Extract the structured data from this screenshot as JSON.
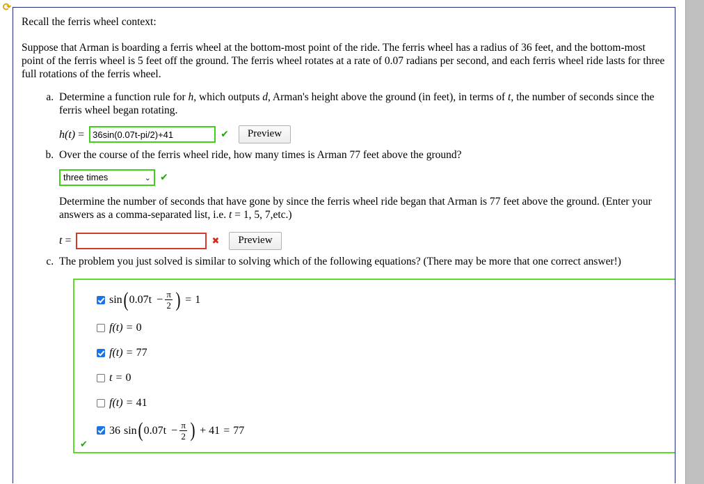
{
  "reload_icon": "⟳",
  "intro": {
    "recall_line": "Recall the ferris wheel context:",
    "setup_text": "Suppose that Arman is boarding a ferris wheel at the bottom-most point of the ride. The ferris wheel has a radius of 36 feet, and the bottom-most point of the ferris wheel is 5 feet off the ground. The ferris wheel rotates at a rate of 0.07 radians per second, and each ferris wheel ride lasts for three full rotations of the ferris wheel."
  },
  "part_a": {
    "prompt": "Determine a function rule for h, which outputs d, Arman's height above the ground (in feet), in terms of t, the number of seconds since the ferris wheel began rotating.",
    "label_fn": "h(t)",
    "label_eq": "=",
    "input_value": "36sin(0.07t-pi/2)+41",
    "status_mark": "✔",
    "status": "correct",
    "preview_label": "Preview"
  },
  "part_b": {
    "prompt": "Over the course of the ferris wheel ride, how many times is Arman 77 feet above the ground?",
    "select_value": "three times",
    "select_chevron": "⌄",
    "select_status_mark": "✔",
    "follow_up": "Determine the number of seconds that have gone by since the ferris wheel ride began that Arman is 77 feet above the ground. (Enter your answers as a comma-separated list, i.e. t = 1, 5, 7,etc.)",
    "label_t": "t",
    "label_eq": "=",
    "input_value": "",
    "status_mark": "✖",
    "status": "incorrect",
    "preview_label": "Preview"
  },
  "part_c": {
    "prompt": "The problem you just solved is similar to solving which of the following equations? (There may be more that one correct answer!)",
    "panel_status_mark": "✔",
    "choices": [
      {
        "checked": true,
        "kind": "sin_fraction",
        "coefficient": "",
        "func": "sin",
        "arg_left": "0.07t",
        "minus": "−",
        "frac_num": "π",
        "frac_den": "2",
        "tail": "",
        "equals": "=",
        "rhs": "1",
        "plain": "sin(0.07t − π/2) = 1"
      },
      {
        "checked": false,
        "kind": "plain",
        "plain": "f(t) = 0",
        "lhs_fn": "f",
        "lhs_arg": "(t)",
        "equals": "=",
        "rhs": "0"
      },
      {
        "checked": true,
        "kind": "plain",
        "plain": "f(t) = 77",
        "lhs_fn": "f",
        "lhs_arg": "(t)",
        "equals": "=",
        "rhs": "77"
      },
      {
        "checked": false,
        "kind": "plain",
        "plain": "t = 0",
        "lhs_fn": "t",
        "lhs_arg": "",
        "equals": "=",
        "rhs": "0"
      },
      {
        "checked": false,
        "kind": "plain",
        "plain": "f(t) = 41",
        "lhs_fn": "f",
        "lhs_arg": "(t)",
        "equals": "=",
        "rhs": "41"
      },
      {
        "checked": true,
        "kind": "sin_fraction",
        "coefficient": "36",
        "func": "sin",
        "arg_left": "0.07t",
        "minus": "−",
        "frac_num": "π",
        "frac_den": "2",
        "tail": "+ 41",
        "equals": "=",
        "rhs": "77",
        "plain": "36 sin(0.07t − π/2) + 41 = 77"
      }
    ]
  },
  "colors": {
    "frame_border": "#1f2a7a",
    "correct_green": "#3fd117",
    "panel_green": "#5fdb2a",
    "incorrect_red": "#d03c2a",
    "checkbox_blue": "#1a73e8",
    "reload_gold": "#d9a400",
    "scrollbar_gray": "#c3c3c3"
  }
}
